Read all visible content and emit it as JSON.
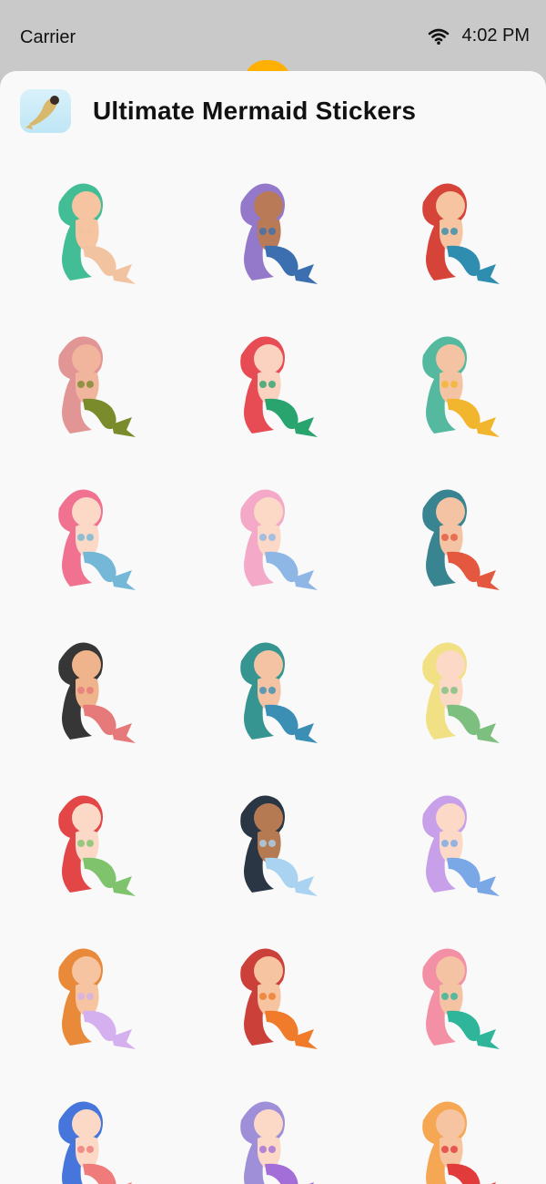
{
  "status": {
    "carrier": "Carrier",
    "time": "4:02 PM"
  },
  "header": {
    "title": "Ultimate Mermaid Stickers"
  },
  "stickers": [
    {
      "name": "mermaid-1",
      "tail": "#f2c3a0",
      "hair": "#39b98f",
      "skin": "#f6c4a0"
    },
    {
      "name": "mermaid-2",
      "tail": "#3c6fb0",
      "hair": "#8e72c8",
      "skin": "#b97a57"
    },
    {
      "name": "mermaid-3",
      "tail": "#2f8db0",
      "hair": "#d43a2e",
      "skin": "#f6c4a0"
    },
    {
      "name": "mermaid-4",
      "tail": "#7a8b2c",
      "hair": "#e08f8f",
      "skin": "#f1b49c"
    },
    {
      "name": "mermaid-5",
      "tail": "#2aa46f",
      "hair": "#e6414a",
      "skin": "#fbd2bf"
    },
    {
      "name": "mermaid-6",
      "tail": "#f2b62e",
      "hair": "#4bb59a",
      "skin": "#f4c3a3"
    },
    {
      "name": "mermaid-7",
      "tail": "#74b7d6",
      "hair": "#f06a8a",
      "skin": "#fbd9c6"
    },
    {
      "name": "mermaid-8",
      "tail": "#8fb7e6",
      "hair": "#f2a4c4",
      "skin": "#fbd9c6"
    },
    {
      "name": "mermaid-9",
      "tail": "#e3583e",
      "hair": "#2d7d8a",
      "skin": "#f4c3a3"
    },
    {
      "name": "mermaid-10",
      "tail": "#e6797a",
      "hair": "#2b2b2b",
      "skin": "#f0b48c"
    },
    {
      "name": "mermaid-11",
      "tail": "#3b8fb5",
      "hair": "#2b8f8a",
      "skin": "#f4c3a3"
    },
    {
      "name": "mermaid-12",
      "tail": "#7dbf7f",
      "hair": "#f1df7d",
      "skin": "#fbd9c6"
    },
    {
      "name": "mermaid-13",
      "tail": "#7fc36d",
      "hair": "#e23c3c",
      "skin": "#fbd9c6"
    },
    {
      "name": "mermaid-14",
      "tail": "#a9d3f0",
      "hair": "#1f2b3a",
      "skin": "#b67a53"
    },
    {
      "name": "mermaid-15",
      "tail": "#7aa8e6",
      "hair": "#c59be8",
      "skin": "#fbd9c6"
    },
    {
      "name": "mermaid-16",
      "tail": "#d5b0ee",
      "hair": "#e8832f",
      "skin": "#f6c4a0"
    },
    {
      "name": "mermaid-17",
      "tail": "#ef7b2b",
      "hair": "#c9362f",
      "skin": "#f6c4a0"
    },
    {
      "name": "mermaid-18",
      "tail": "#2fb59a",
      "hair": "#f28aa0",
      "skin": "#f4c3a3"
    },
    {
      "name": "mermaid-19",
      "tail": "#ef7b7b",
      "hair": "#3c6fd9",
      "skin": "#fbd9c6"
    },
    {
      "name": "mermaid-20",
      "tail": "#a36ed8",
      "hair": "#9a88d6",
      "skin": "#fbd9c6"
    },
    {
      "name": "mermaid-21",
      "tail": "#e23b3b",
      "hair": "#f4a24a",
      "skin": "#f6c4a0"
    }
  ]
}
